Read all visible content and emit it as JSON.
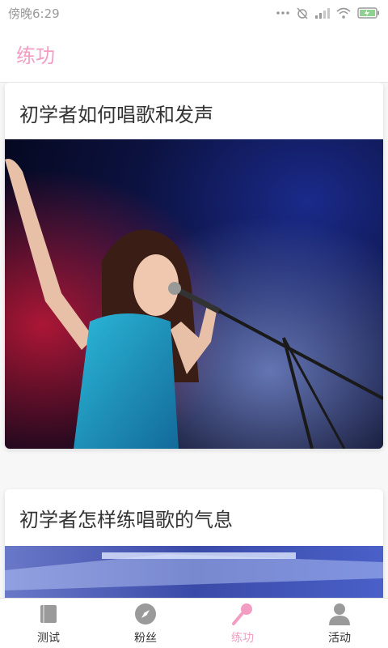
{
  "status_bar": {
    "time": "傍晚6:29",
    "icons": [
      "more-dots-icon",
      "alarm-off-icon",
      "signal-icon",
      "wifi-icon",
      "battery-charging-icon"
    ]
  },
  "header": {
    "title": "练功",
    "title_color": "#f39dc2"
  },
  "articles": [
    {
      "title": "初学者如何唱歌和发声",
      "image": "singer-performing-stage-photo"
    },
    {
      "title": "初学者怎样练唱歌的气息",
      "image": "stage-lights-photo"
    }
  ],
  "bottom_nav": {
    "items": [
      {
        "label": "测试",
        "icon": "book-icon"
      },
      {
        "label": "粉丝",
        "icon": "compass-icon"
      },
      {
        "label": "练功",
        "icon": "microphone-icon",
        "active": true
      },
      {
        "label": "活动",
        "icon": "person-icon"
      }
    ],
    "active_color": "#f39dc2",
    "inactive_color": "#9a9a9a"
  }
}
